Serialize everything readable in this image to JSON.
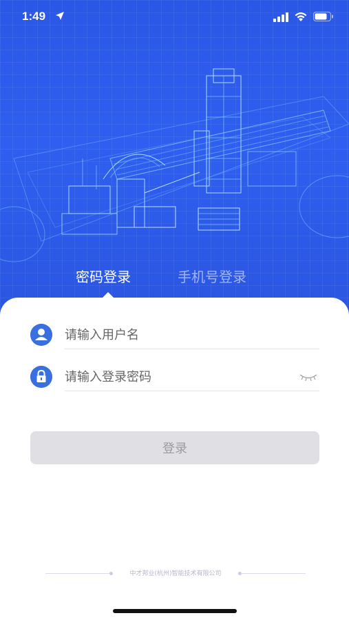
{
  "status_bar": {
    "time": "1:49",
    "icons": [
      "location-arrow-icon",
      "cellular-signal-icon",
      "wifi-icon",
      "battery-icon"
    ]
  },
  "hero": {
    "image": "factory-blueprint-illustration"
  },
  "tabs": [
    {
      "label": "密码登录",
      "active": true
    },
    {
      "label": "手机号登录",
      "active": false
    }
  ],
  "form": {
    "username": {
      "value": "",
      "placeholder": "请输入用户名",
      "icon": "user-icon"
    },
    "password": {
      "value": "",
      "placeholder": "请输入登录密码",
      "icon": "lock-icon",
      "toggle_icon": "eye-closed-icon"
    },
    "login_label": "登录"
  },
  "footer": {
    "company": "中才邦业(杭州)智能技术有限公司"
  },
  "colors": {
    "hero_blue": "#2f5ff0",
    "icon_blue": "#3a6fe0",
    "button_disabled": "#e0e0e4"
  }
}
